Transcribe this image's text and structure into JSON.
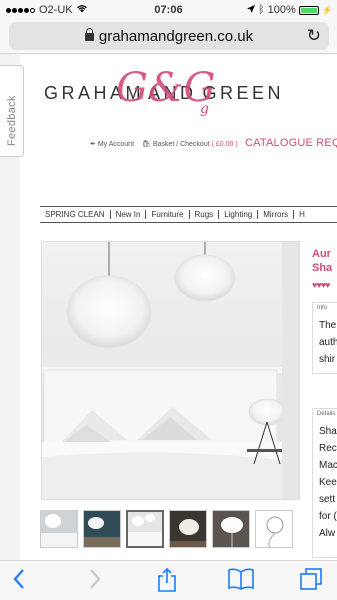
{
  "status": {
    "carrier": "O2-UK",
    "time": "07:06",
    "battery": "100%",
    "battery_fraction": 1.0
  },
  "browser": {
    "url": "grahamandgreen.co.uk",
    "lock_icon": "lock-icon",
    "reload_icon": "reload-icon"
  },
  "feedback": {
    "label": "Feedback"
  },
  "header": {
    "brand": "GRAHAM AND GREEN",
    "brand_left": "GRAHAM",
    "brand_and": "AND",
    "brand_right": "GREEN",
    "monogram": "G&G",
    "monogram_g": "g",
    "my_account": "My Account",
    "basket": "Basket / Checkout",
    "basket_total": "( £0.00 )",
    "catalogue": "CATALOGUE REQ"
  },
  "nav": {
    "items": [
      {
        "label": "SPRING CLEAN"
      },
      {
        "label": "New In"
      },
      {
        "label": "Furniture"
      },
      {
        "label": "Rugs"
      },
      {
        "label": "Lighting"
      },
      {
        "label": "Mirrors"
      },
      {
        "label": "H"
      }
    ]
  },
  "product": {
    "title_line1": "Aur",
    "title_line2": "Sha",
    "rating": "♥♥♥♥",
    "info_label": "Info",
    "info_lines": [
      "The",
      "auth",
      "shir"
    ],
    "details_label": "Details",
    "details_lines": [
      "Sha",
      "Rec",
      "Mac",
      "Kee",
      "sett",
      "for (",
      "Alw"
    ]
  },
  "colors": {
    "brand_pink": "#d14b7b",
    "ios_blue": "#1a7cff"
  }
}
